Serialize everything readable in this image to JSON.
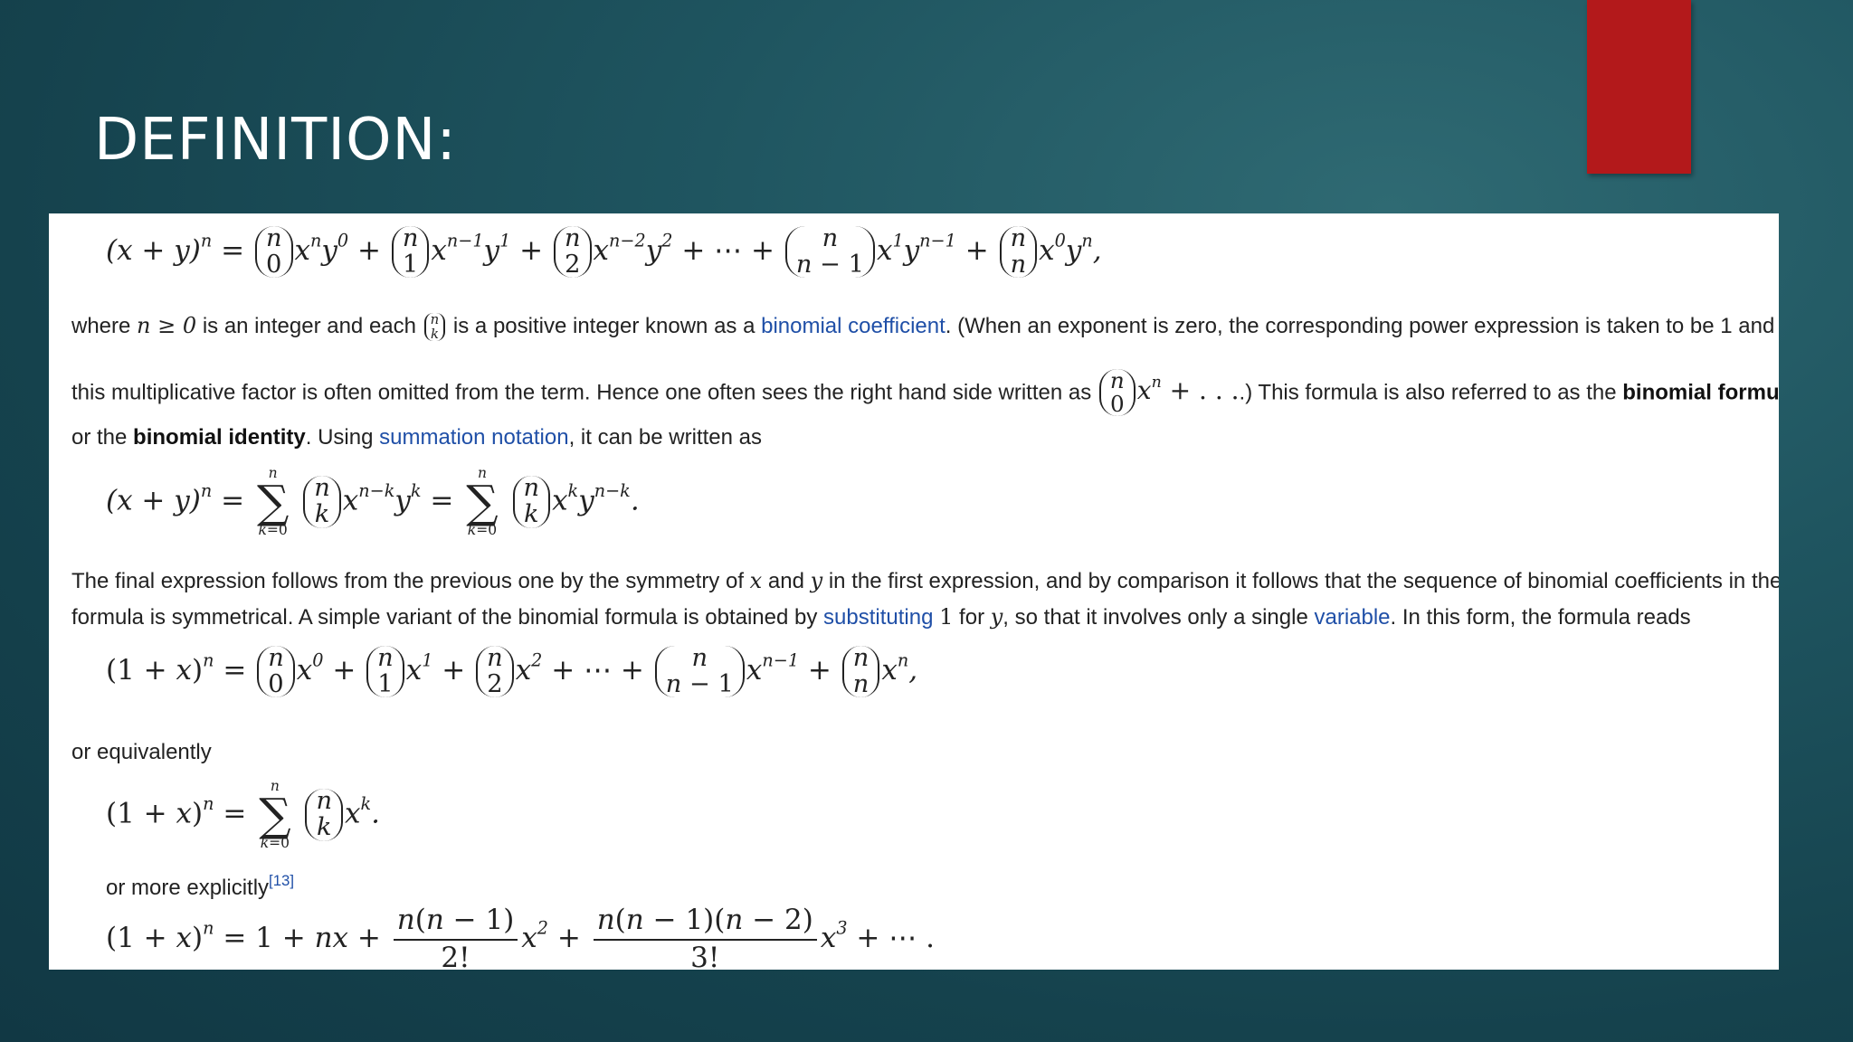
{
  "slide": {
    "title": "DEFINITION:"
  },
  "text": {
    "p1_where": "where",
    "p1_cond": "n ≥ 0",
    "p1_a": "is an integer and each",
    "p1_b": "is a positive integer known as a",
    "p1_link": "binomial coefficient",
    "p1_c": ". (When an exponent is zero, the corresponding power expression is taken to be 1 and",
    "p2_a": "this multiplicative factor is often omitted from the term. Hence one often sees the right hand side written as",
    "p2_b": ".) This formula is also referred to as the",
    "p2_bold": "binomial formula",
    "p3_a": "or the",
    "p3_bold": "binomial identity",
    "p3_b": ". Using",
    "p3_link": "summation notation",
    "p3_c": ", it can be written as",
    "p4_a": "The final expression follows from the previous one by the symmetry of",
    "p4_x": "x",
    "p4_and": "and",
    "p4_y": "y",
    "p4_b": "in the first expression, and by comparison it follows that the sequence of binomial coefficients in the",
    "p5_a": "formula is symmetrical. A simple variant of the binomial formula is obtained by",
    "p5_link1": "substituting",
    "p5_one": "1",
    "p5_for": "for",
    "p5_y": "y",
    "p5_b": ", so that it involves only a single",
    "p5_link2": "variable",
    "p5_c": ". In this form, the formula reads",
    "p6": "or equivalently",
    "p7": "or more explicitly",
    "p7_ref": "[13]"
  }
}
